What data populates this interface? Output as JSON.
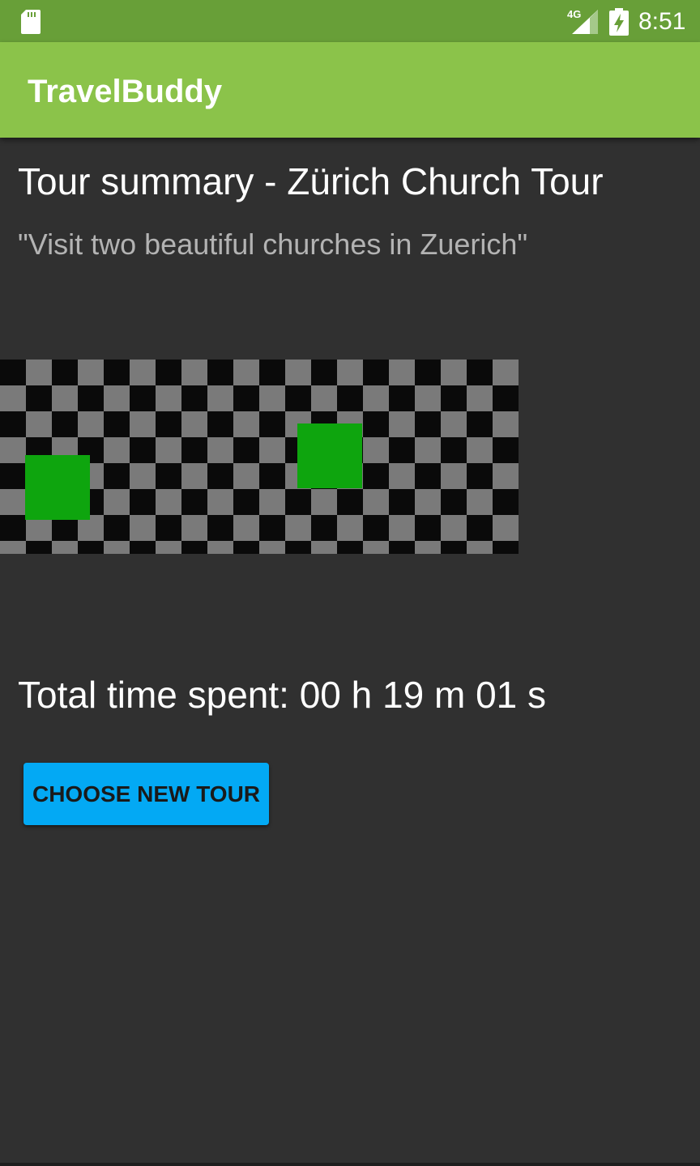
{
  "status_bar": {
    "network": "4G",
    "time": "8:51",
    "icons": [
      "sd-card-icon",
      "signal-icon",
      "battery-charging-icon"
    ],
    "background": "#689f38"
  },
  "app_bar": {
    "title": "TravelBuddy",
    "background": "#8bc34a"
  },
  "summary": {
    "title": "Tour summary - Zürich Church Tour",
    "description": "\"Visit two beautiful churches in Zuerich\"",
    "images": [
      {
        "name": "tour-image-1"
      },
      {
        "name": "tour-image-2"
      }
    ],
    "total_time": "Total time spent: 00 h 19 m 01 s",
    "button_label": "CHOOSE NEW TOUR"
  },
  "colors": {
    "background": "#303030",
    "accent": "#03a9f4",
    "placeholder_green": "#0ea50e"
  }
}
